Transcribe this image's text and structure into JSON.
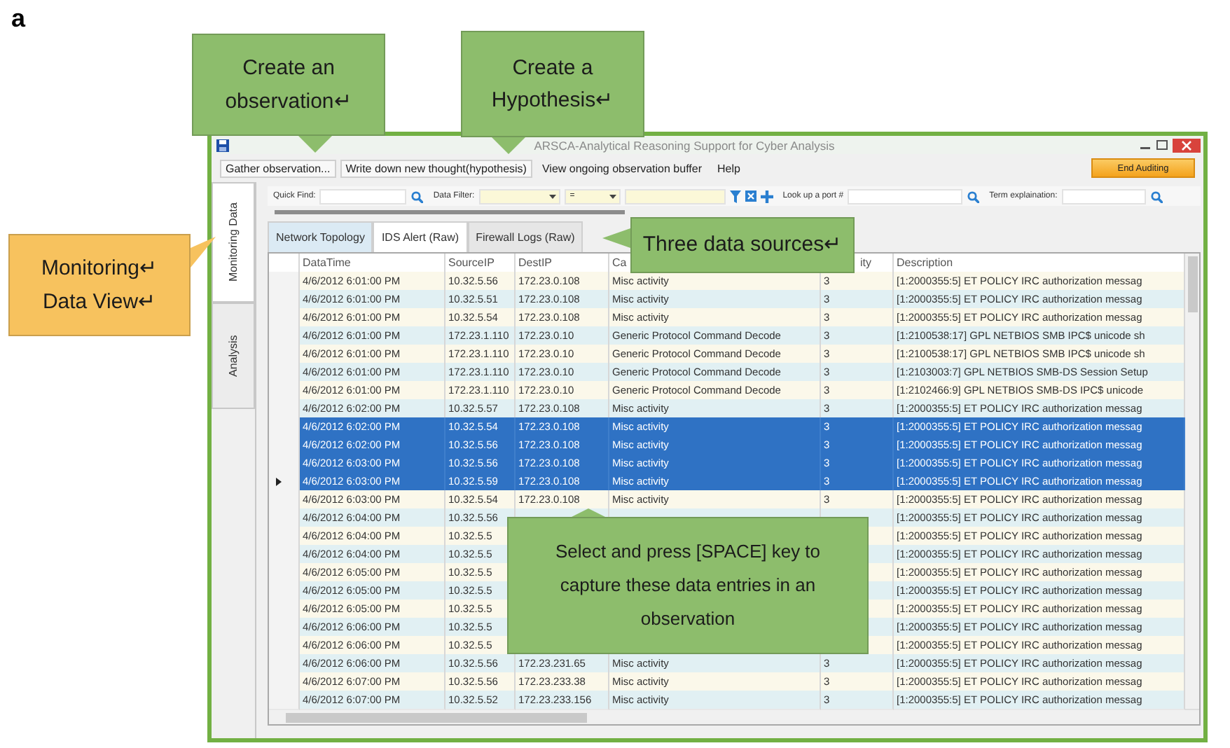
{
  "figure_label": "a",
  "window": {
    "title": "ARSCA-Analytical Reasoning Support for Cyber Analysis"
  },
  "menu": [
    {
      "label": "Gather observation...",
      "kind": "button"
    },
    {
      "label": "Write down new thought(hypothesis)",
      "kind": "button"
    },
    {
      "label": "View ongoing observation buffer",
      "kind": "item"
    },
    {
      "label": "Help",
      "kind": "item"
    }
  ],
  "end_button": "End Auditing",
  "filter_bar": {
    "quick_find": "Quick Find:",
    "data_filter": "Data Filter:",
    "operator": "=",
    "port_lookup": "Look up a port #",
    "term_lookup": "Term explaination:"
  },
  "sidebar_tabs": [
    {
      "label": "Monitoring Data",
      "selected": true
    },
    {
      "label": "Analysis",
      "selected": false
    }
  ],
  "tabs": [
    {
      "label": "Network Topology",
      "selected": false,
      "hovered": true
    },
    {
      "label": "IDS Alert (Raw)",
      "selected": true,
      "hovered": false
    },
    {
      "label": "Firewall Logs (Raw)",
      "selected": false,
      "hovered": false
    }
  ],
  "table": {
    "columns": [
      "DataTime",
      "SourceIP",
      "DestIP",
      "Ca",
      "ity",
      "Description"
    ],
    "rows": [
      {
        "cells": [
          "4/6/2012 6:01:00 PM",
          "10.32.5.56",
          "172.23.0.108",
          "Misc activity",
          "3",
          "[1:2000355:5] ET POLICY IRC authorization messag"
        ],
        "selected": false,
        "current": false
      },
      {
        "cells": [
          "4/6/2012 6:01:00 PM",
          "10.32.5.51",
          "172.23.0.108",
          "Misc activity",
          "3",
          "[1:2000355:5] ET POLICY IRC authorization messag"
        ],
        "selected": false,
        "current": false
      },
      {
        "cells": [
          "4/6/2012 6:01:00 PM",
          "10.32.5.54",
          "172.23.0.108",
          "Misc activity",
          "3",
          "[1:2000355:5] ET POLICY IRC authorization messag"
        ],
        "selected": false,
        "current": false
      },
      {
        "cells": [
          "4/6/2012 6:01:00 PM",
          "172.23.1.110",
          "172.23.0.10",
          "Generic Protocol Command Decode",
          "3",
          "[1:2100538:17] GPL NETBIOS SMB IPC$ unicode sh"
        ],
        "selected": false,
        "current": false
      },
      {
        "cells": [
          "4/6/2012 6:01:00 PM",
          "172.23.1.110",
          "172.23.0.10",
          "Generic Protocol Command Decode",
          "3",
          "[1:2100538:17] GPL NETBIOS SMB IPC$ unicode sh"
        ],
        "selected": false,
        "current": false
      },
      {
        "cells": [
          "4/6/2012 6:01:00 PM",
          "172.23.1.110",
          "172.23.0.10",
          "Generic Protocol Command Decode",
          "3",
          "[1:2103003:7] GPL NETBIOS SMB-DS Session Setup"
        ],
        "selected": false,
        "current": false
      },
      {
        "cells": [
          "4/6/2012 6:01:00 PM",
          "172.23.1.110",
          "172.23.0.10",
          "Generic Protocol Command Decode",
          "3",
          "[1:2102466:9] GPL NETBIOS SMB-DS IPC$ unicode"
        ],
        "selected": false,
        "current": false
      },
      {
        "cells": [
          "4/6/2012 6:02:00 PM",
          "10.32.5.57",
          "172.23.0.108",
          "Misc activity",
          "3",
          "[1:2000355:5] ET POLICY IRC authorization messag"
        ],
        "selected": false,
        "current": false
      },
      {
        "cells": [
          "4/6/2012 6:02:00 PM",
          "10.32.5.54",
          "172.23.0.108",
          "Misc activity",
          "3",
          "[1:2000355:5] ET POLICY IRC authorization messag"
        ],
        "selected": true,
        "current": false
      },
      {
        "cells": [
          "4/6/2012 6:02:00 PM",
          "10.32.5.56",
          "172.23.0.108",
          "Misc activity",
          "3",
          "[1:2000355:5] ET POLICY IRC authorization messag"
        ],
        "selected": true,
        "current": false
      },
      {
        "cells": [
          "4/6/2012 6:03:00 PM",
          "10.32.5.56",
          "172.23.0.108",
          "Misc activity",
          "3",
          "[1:2000355:5] ET POLICY IRC authorization messag"
        ],
        "selected": true,
        "current": false
      },
      {
        "cells": [
          "4/6/2012 6:03:00 PM",
          "10.32.5.59",
          "172.23.0.108",
          "Misc activity",
          "3",
          "[1:2000355:5] ET POLICY IRC authorization messag"
        ],
        "selected": true,
        "current": true
      },
      {
        "cells": [
          "4/6/2012 6:03:00 PM",
          "10.32.5.54",
          "172.23.0.108",
          "Misc activity",
          "3",
          "[1:2000355:5] ET POLICY IRC authorization messag"
        ],
        "selected": false,
        "current": false
      },
      {
        "cells": [
          "4/6/2012 6:04:00 PM",
          "10.32.5.56",
          null,
          null,
          null,
          "[1:2000355:5] ET POLICY IRC authorization messag"
        ],
        "selected": false,
        "current": false
      },
      {
        "cells": [
          "4/6/2012 6:04:00 PM",
          "10.32.5.5",
          null,
          null,
          null,
          "[1:2000355:5] ET POLICY IRC authorization messag"
        ],
        "selected": false,
        "current": false
      },
      {
        "cells": [
          "4/6/2012 6:04:00 PM",
          "10.32.5.5",
          null,
          null,
          null,
          "[1:2000355:5] ET POLICY IRC authorization messag"
        ],
        "selected": false,
        "current": false
      },
      {
        "cells": [
          "4/6/2012 6:05:00 PM",
          "10.32.5.5",
          null,
          null,
          null,
          "[1:2000355:5] ET POLICY IRC authorization messag"
        ],
        "selected": false,
        "current": false
      },
      {
        "cells": [
          "4/6/2012 6:05:00 PM",
          "10.32.5.5",
          null,
          null,
          null,
          "[1:2000355:5] ET POLICY IRC authorization messag"
        ],
        "selected": false,
        "current": false
      },
      {
        "cells": [
          "4/6/2012 6:05:00 PM",
          "10.32.5.5",
          null,
          null,
          null,
          "[1:2000355:5] ET POLICY IRC authorization messag"
        ],
        "selected": false,
        "current": false
      },
      {
        "cells": [
          "4/6/2012 6:06:00 PM",
          "10.32.5.5",
          null,
          null,
          null,
          "[1:2000355:5] ET POLICY IRC authorization messag"
        ],
        "selected": false,
        "current": false
      },
      {
        "cells": [
          "4/6/2012 6:06:00 PM",
          "10.32.5.5",
          null,
          null,
          null,
          "[1:2000355:5] ET POLICY IRC authorization messag"
        ],
        "selected": false,
        "current": false
      },
      {
        "cells": [
          "4/6/2012 6:06:00 PM",
          "10.32.5.56",
          "172.23.231.65",
          "Misc activity",
          "3",
          "[1:2000355:5] ET POLICY IRC authorization messag"
        ],
        "selected": false,
        "current": false
      },
      {
        "cells": [
          "4/6/2012 6:07:00 PM",
          "10.32.5.56",
          "172.23.233.38",
          "Misc activity",
          "3",
          "[1:2000355:5] ET POLICY IRC authorization messag"
        ],
        "selected": false,
        "current": false
      },
      {
        "cells": [
          "4/6/2012 6:07:00 PM",
          "10.32.5.52",
          "172.23.233.156",
          "Misc activity",
          "3",
          "[1:2000355:5] ET POLICY IRC authorization messag"
        ],
        "selected": false,
        "current": false
      }
    ]
  },
  "callouts": [
    {
      "lines": [
        "Create an",
        "observation↵"
      ],
      "color": "#8dbd6c"
    },
    {
      "lines": [
        "Create a",
        "Hypothesis↵"
      ],
      "color": "#8dbd6c"
    },
    {
      "lines": [
        "Monitoring↵",
        "Data View↵"
      ],
      "color": "#f7c25e"
    },
    {
      "lines": [
        "Three data sources↵"
      ],
      "color": "#8dbd6c"
    },
    {
      "lines": [
        "Select and press [SPACE] key to",
        "capture these data entries in an",
        "observation"
      ],
      "color": "#8dbd6c"
    }
  ]
}
